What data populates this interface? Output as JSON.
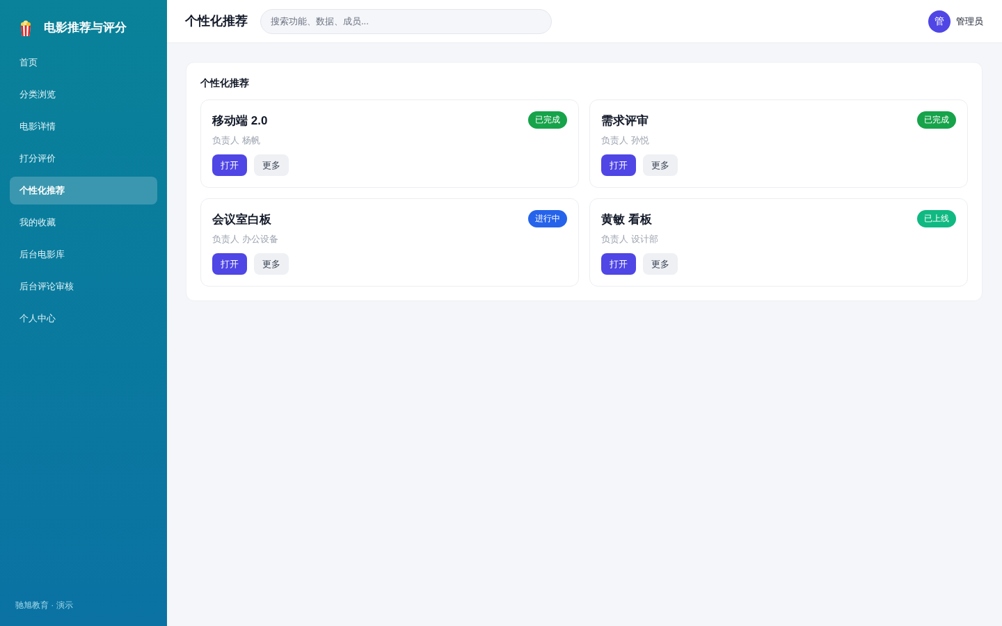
{
  "sidebar": {
    "brand": "电影推荐与评分",
    "items": [
      {
        "label": "首页",
        "selected": false
      },
      {
        "label": "分类浏览",
        "selected": false
      },
      {
        "label": "电影详情",
        "selected": false
      },
      {
        "label": "打分评价",
        "selected": false
      },
      {
        "label": "个性化推荐",
        "selected": true
      },
      {
        "label": "我的收藏",
        "selected": false
      },
      {
        "label": "后台电影库",
        "selected": false
      },
      {
        "label": "后台评论审核",
        "selected": false
      },
      {
        "label": "个人中心",
        "selected": false
      }
    ],
    "footer": "驰旭教育 · 演示"
  },
  "header": {
    "title": "个性化推荐",
    "search": {
      "placeholder": "搜索功能、数据、成员..."
    },
    "user": {
      "avatar": "管",
      "name": "管理员"
    }
  },
  "panel": {
    "title": "个性化推荐",
    "cards": [
      {
        "title": "移动端 2.0",
        "status": {
          "label": "已完成",
          "color": "#16a34a"
        },
        "owner": "负责人 杨帆",
        "actions": [
          {
            "label": "打开",
            "kind": "primary"
          },
          {
            "label": "更多",
            "kind": "secondary"
          }
        ]
      },
      {
        "title": "需求评审",
        "status": {
          "label": "已完成",
          "color": "#16a34a"
        },
        "owner": "负责人 孙悦",
        "actions": [
          {
            "label": "打开",
            "kind": "primary"
          },
          {
            "label": "更多",
            "kind": "secondary"
          }
        ]
      },
      {
        "title": "会议室白板",
        "status": {
          "label": "进行中",
          "color": "#2563eb"
        },
        "owner": "负责人 办公设备",
        "actions": [
          {
            "label": "打开",
            "kind": "primary"
          },
          {
            "label": "更多",
            "kind": "secondary"
          }
        ]
      },
      {
        "title": "黄敏 看板",
        "status": {
          "label": "已上线",
          "color": "#10b981"
        },
        "owner": "负责人 设计部",
        "actions": [
          {
            "label": "打开",
            "kind": "primary"
          },
          {
            "label": "更多",
            "kind": "secondary"
          }
        ]
      }
    ]
  }
}
